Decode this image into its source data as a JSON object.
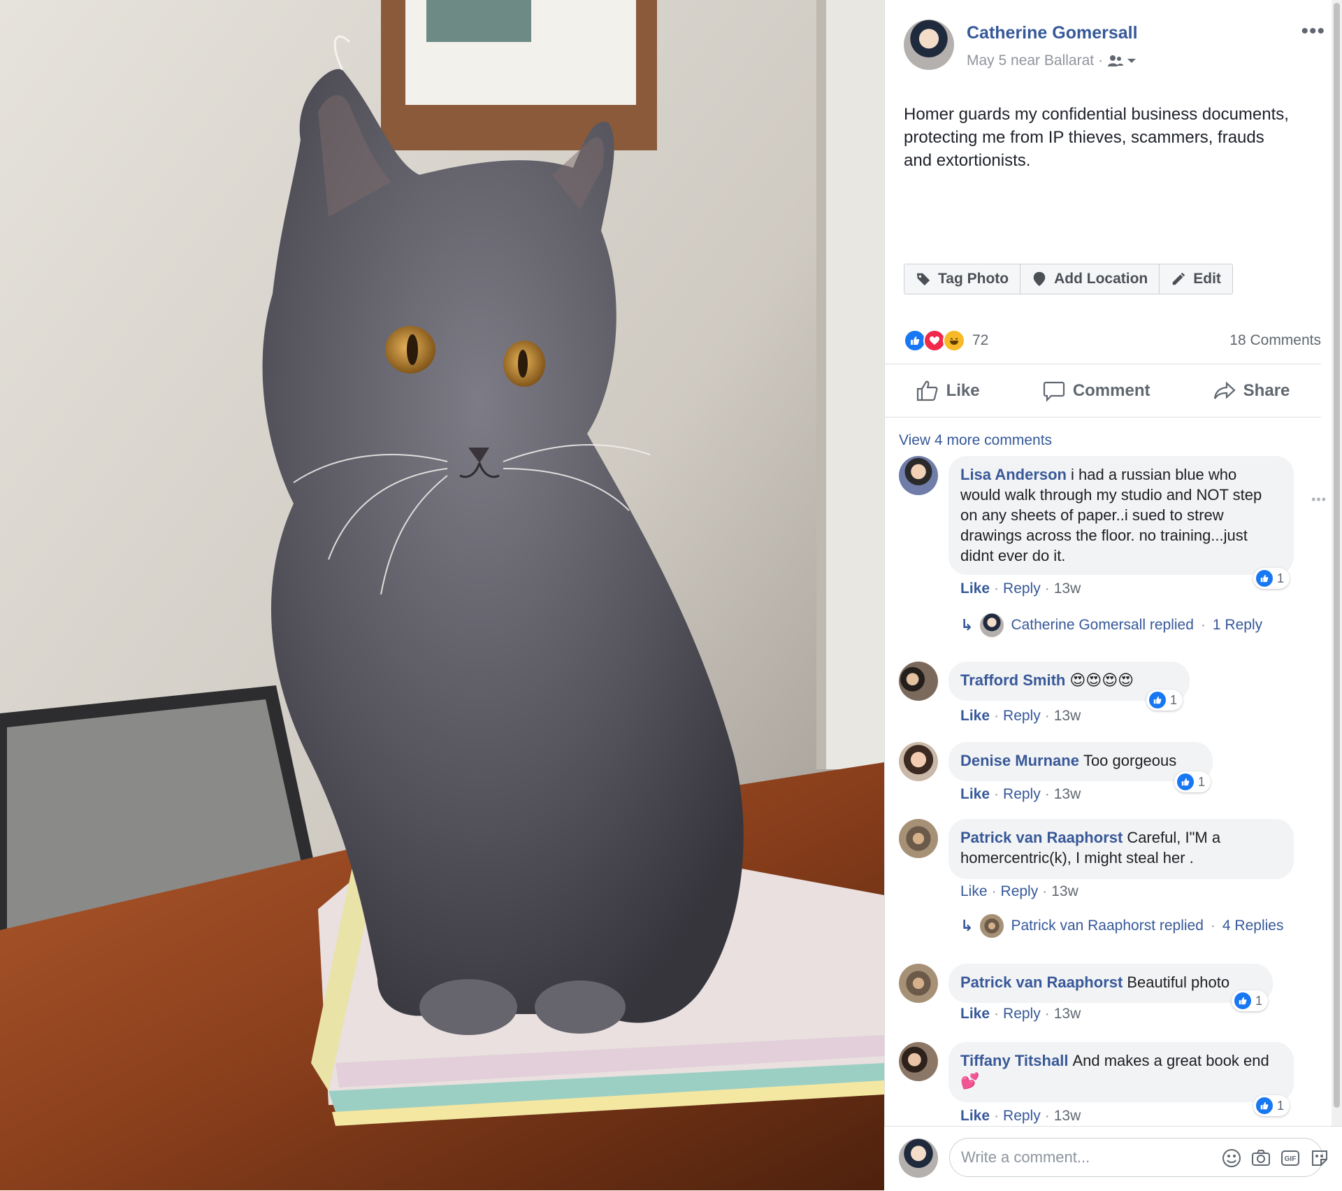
{
  "post": {
    "author": "Catherine Gomersall",
    "meta": "May 5 near Ballarat",
    "meta_separator": "·",
    "audience_icon": "friends-icon",
    "text": "Homer guards my confidential business documents, protecting me from IP thieves, scammers, frauds and extortionists.",
    "more_icon": "•••"
  },
  "photo_actions": {
    "tag": "Tag Photo",
    "location": "Add Location",
    "edit": "Edit"
  },
  "reactions": {
    "icons": [
      "like-reaction-icon",
      "love-reaction-icon",
      "haha-reaction-icon"
    ],
    "count": "72",
    "comments": "18 Comments"
  },
  "actions": {
    "like": "Like",
    "comment": "Comment",
    "share": "Share"
  },
  "comments_section": {
    "view_more": "View 4 more comments",
    "comments": [
      {
        "name": "Lisa Anderson",
        "text": "i had a russian blue who would walk through my studio and NOT step on any sheets of paper..i sued to strew drawings across the floor. no training...just didnt ever do it.",
        "like": "Like",
        "reply": "Reply",
        "time": "13w",
        "likes": "1",
        "replied": "Catherine Gomersall replied",
        "replies": "1 Reply"
      },
      {
        "name": "Trafford Smith",
        "text": "😍😍😍😍",
        "like": "Like",
        "reply": "Reply",
        "time": "13w",
        "likes": "1"
      },
      {
        "name": "Denise Murnane",
        "text": "Too gorgeous",
        "like": "Like",
        "reply": "Reply",
        "time": "13w",
        "likes": "1"
      },
      {
        "name": "Patrick van Raaphorst",
        "text": "Careful, I\"M a homercentric(k), I might steal her .",
        "like": "Like",
        "reply": "Reply",
        "time": "13w",
        "replied": "Patrick van Raaphorst replied",
        "replies": "4 Replies"
      },
      {
        "name": "Patrick van Raaphorst",
        "text": "Beautiful photo",
        "like": "Like",
        "reply": "Reply",
        "time": "13w",
        "likes": "1"
      },
      {
        "name": "Tiffany Titshall",
        "text": "And makes a great book end 💕",
        "like": "Like",
        "reply": "Reply",
        "time": "13w",
        "likes": "1"
      }
    ]
  },
  "composer": {
    "placeholder": "Write a comment...",
    "icons": [
      "emoji-icon",
      "camera-icon",
      "gif-icon",
      "sticker-icon"
    ],
    "gif_label": "GIF"
  },
  "colors": {
    "link": "#365899",
    "like_blue": "#1877f2",
    "love_red": "#f0284a",
    "haha_yellow": "#f7b928"
  }
}
